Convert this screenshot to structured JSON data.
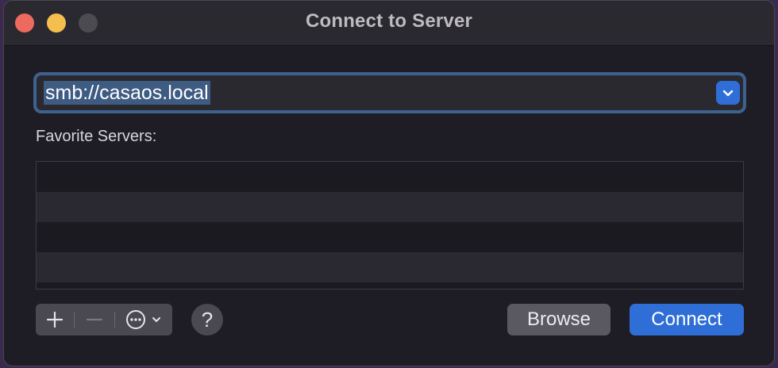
{
  "window": {
    "title": "Connect to Server"
  },
  "server_address": {
    "value": "smb://casaos.local"
  },
  "favorites": {
    "label": "Favorite Servers:",
    "items": []
  },
  "toolbar": {
    "add_icon": "plus-icon",
    "remove_icon": "minus-icon",
    "more_icon": "ellipsis-circle-icon",
    "help_label": "?"
  },
  "buttons": {
    "browse_label": "Browse",
    "connect_label": "Connect"
  },
  "colors": {
    "accent": "#2f6ed6",
    "close": "#ed6a5e",
    "minimize": "#f5bf4f"
  }
}
